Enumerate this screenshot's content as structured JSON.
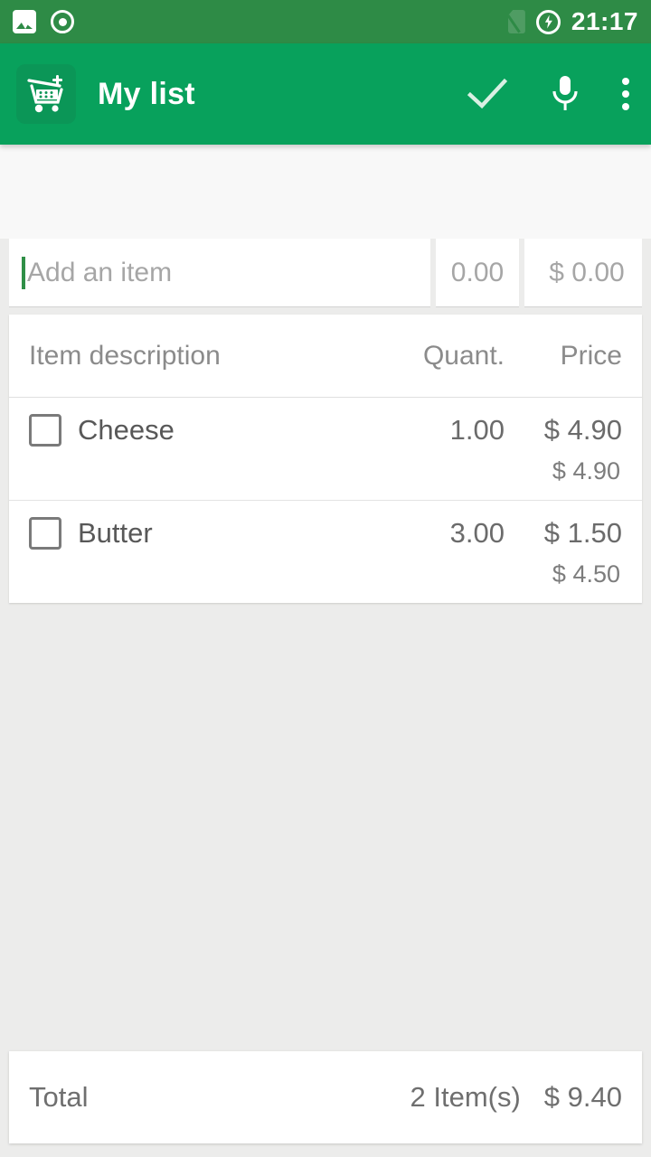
{
  "statusbar": {
    "time": "21:17",
    "left_icons": [
      "image-icon",
      "screen-record-icon"
    ],
    "right_icons": [
      "no-sim-icon",
      "charging-icon"
    ]
  },
  "toolbar": {
    "app_icon": "shopping-cart-add-icon",
    "title": "My list",
    "actions": [
      {
        "name": "confirm-check-button",
        "icon": "check-icon"
      },
      {
        "name": "voice-input-button",
        "icon": "microphone-icon"
      },
      {
        "name": "overflow-menu-button",
        "icon": "more-vertical-icon"
      }
    ]
  },
  "add_item": {
    "description_placeholder": "Add an item",
    "description_value": "",
    "quantity_value": "0.00",
    "price_value": "$ 0.00"
  },
  "list": {
    "headers": {
      "description": "Item description",
      "quantity": "Quant.",
      "price": "Price"
    },
    "rows": [
      {
        "checked": false,
        "name": "Cheese",
        "quantity": "1.00",
        "price": "$ 4.90",
        "subtotal": "$ 4.90"
      },
      {
        "checked": false,
        "name": "Butter",
        "quantity": "3.00",
        "price": "$ 1.50",
        "subtotal": "$ 4.50"
      }
    ]
  },
  "total": {
    "label": "Total",
    "count": "2 Item(s)",
    "value": "$ 9.40"
  },
  "colors": {
    "status_bar": "#2e8b46",
    "toolbar": "#08a15c",
    "page_background": "#ececeb",
    "card": "#ffffff",
    "cursor_accent": "#2f8f47",
    "text_primary": "#585858",
    "text_secondary": "#8b8b8b"
  }
}
